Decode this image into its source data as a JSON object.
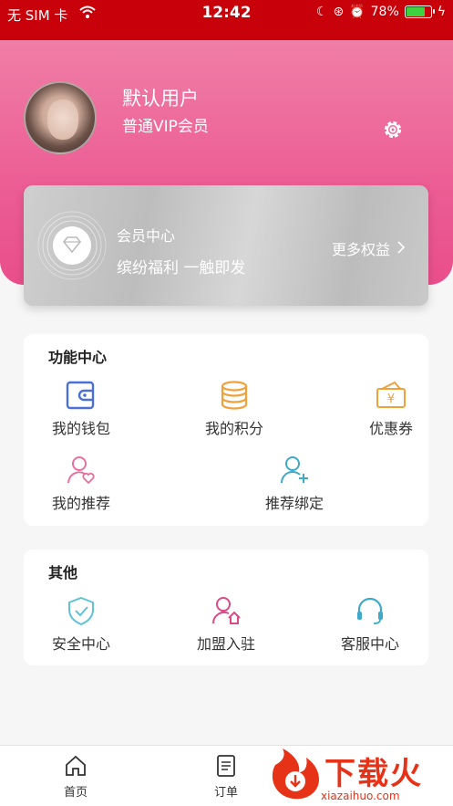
{
  "status_bar": {
    "carrier": "无 SIM 卡",
    "time": "12:42",
    "battery": "78%",
    "battery_level": 0.78
  },
  "profile": {
    "username": "默认用户",
    "member_level": "普通VIP会员"
  },
  "member_card": {
    "title": "会员中心",
    "subtitle": "缤纷福利 一触即发",
    "more_link": "更多权益"
  },
  "function_center": {
    "title": "功能中心",
    "items": [
      {
        "label": "我的钱包",
        "icon": "wallet-icon"
      },
      {
        "label": "我的积分",
        "icon": "coins-icon"
      },
      {
        "label": "优惠券",
        "icon": "coupon-icon"
      },
      {
        "label": "我的推荐",
        "icon": "user-heart-icon"
      },
      {
        "label": "推荐绑定",
        "icon": "user-add-icon"
      }
    ]
  },
  "other": {
    "title": "其他",
    "items": [
      {
        "label": "安全中心",
        "icon": "shield-check-icon"
      },
      {
        "label": "加盟入驻",
        "icon": "user-home-icon"
      },
      {
        "label": "客服中心",
        "icon": "headset-icon"
      }
    ]
  },
  "tabbar": {
    "tabs": [
      {
        "label": "首页",
        "icon": "home-icon"
      },
      {
        "label": "订单",
        "icon": "order-icon"
      }
    ]
  },
  "watermark": {
    "title": "下载火",
    "url": "xiazaihuo.com"
  },
  "colors": {
    "status_bar": "#c8000a",
    "header_pink": "#ec5d94",
    "icon_blue": "#4c6fd6",
    "icon_orange": "#f0a13a",
    "icon_pink": "#e9709c",
    "icon_teal": "#3fa9c9",
    "watermark_red": "#e63317"
  }
}
